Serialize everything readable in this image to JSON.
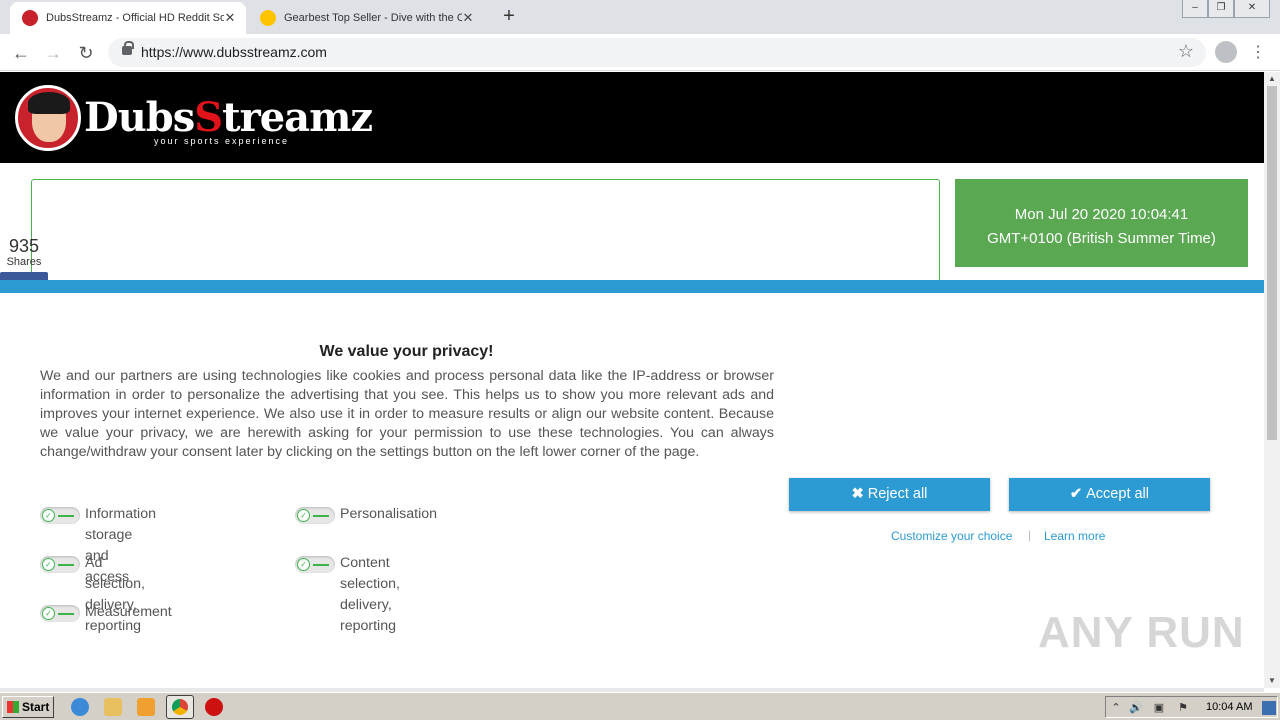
{
  "browser": {
    "tabs": [
      {
        "title": "DubsStreamz - Official HD Reddit So",
        "active": true
      },
      {
        "title": "Gearbest Top Seller - Dive with the C",
        "active": false
      }
    ],
    "url": "https://www.dubsstreamz.com"
  },
  "site": {
    "logo_main": "Dubs",
    "logo_accent": "S",
    "logo_rest": "treamz",
    "tagline": "your sports experience",
    "clock_line1": "Mon Jul 20 2020 10:04:41",
    "clock_line2": "GMT+0100 (British Summer Time)",
    "shares_count": "935",
    "shares_label": "Shares"
  },
  "consent": {
    "title": "We value your privacy!",
    "body": "We and our partners are using technologies like cookies and process personal data like the IP-address or browser information in order to personalize the advertising that you see. This helps us to show you more relevant ads and improves your internet experience. We also use it in order to measure results or align our website content. Because we value your privacy, we are herewith asking for your permission to use these technologies. You can always change/withdraw your consent later by clicking on the settings button on the left lower corner of the page.",
    "purposes": [
      {
        "line1": "Information storage and",
        "line2": "access"
      },
      {
        "line1": "Personalisation",
        "line2": ""
      },
      {
        "line1": "Ad selection, delivery,",
        "line2": "reporting"
      },
      {
        "line1": "Content selection, delivery,",
        "line2": "reporting"
      },
      {
        "line1": "Measurement",
        "line2": ""
      }
    ],
    "reject_label": "Reject all",
    "accept_label": "Accept all",
    "customize_label": "Customize your choice",
    "learn_more_label": "Learn more",
    "separator": "|"
  },
  "watermark": "ANY RUN",
  "taskbar": {
    "start_label": "Start",
    "time": "10:04 AM"
  },
  "colors": {
    "accent_blue": "#2c9ad3",
    "clock_green": "#5aa852",
    "logo_red": "#e0121a"
  }
}
